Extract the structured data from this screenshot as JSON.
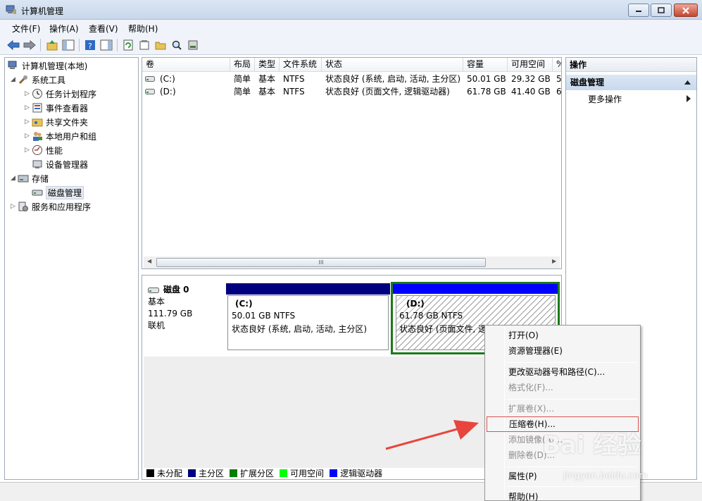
{
  "window": {
    "title": "计算机管理"
  },
  "menu": [
    "文件(F)",
    "操作(A)",
    "查看(V)",
    "帮助(H)"
  ],
  "tree": {
    "root": "计算机管理(本地)",
    "items": [
      {
        "label": "系统工具",
        "icon": "tools-icon"
      },
      {
        "label": "任务计划程序",
        "icon": "clock-icon"
      },
      {
        "label": "事件查看器",
        "icon": "event-viewer-icon"
      },
      {
        "label": "共享文件夹",
        "icon": "shared-folder-icon"
      },
      {
        "label": "本地用户和组",
        "icon": "users-icon"
      },
      {
        "label": "性能",
        "icon": "performance-icon"
      },
      {
        "label": "设备管理器",
        "icon": "device-manager-icon"
      },
      {
        "label": "存储",
        "icon": "storage-icon"
      },
      {
        "label": "磁盘管理",
        "icon": "disk-icon"
      },
      {
        "label": "服务和应用程序",
        "icon": "services-icon"
      }
    ]
  },
  "columns": [
    "卷",
    "布局",
    "类型",
    "文件系统",
    "状态",
    "容量",
    "可用空间",
    "%"
  ],
  "volumes": [
    {
      "name": "(C:)",
      "layout": "简单",
      "type": "基本",
      "fs": "NTFS",
      "status": "状态良好 (系统, 启动, 活动, 主分区)",
      "capacity": "50.01 GB",
      "free": "29.32 GB",
      "pct": "5"
    },
    {
      "name": "(D:)",
      "layout": "简单",
      "type": "基本",
      "fs": "NTFS",
      "status": "状态良好 (页面文件, 逻辑驱动器)",
      "capacity": "61.78 GB",
      "free": "41.40 GB",
      "pct": "6"
    }
  ],
  "scroll_thumb": "III",
  "disk": {
    "name": "磁盘 0",
    "type": "基本",
    "size": "111.79 GB",
    "state": "联机",
    "partitions": [
      {
        "letter": "(C:)",
        "size": "50.01 GB NTFS",
        "status": "状态良好 (系统, 启动, 活动, 主分区)",
        "color": "#00007f"
      },
      {
        "letter": "(D:)",
        "size": "61.78 GB NTFS",
        "status": "状态良好 (页面文件, 逻辑驱动器)",
        "color": "#0000ff"
      }
    ]
  },
  "legend": [
    {
      "label": "未分配",
      "color": "#000000"
    },
    {
      "label": "主分区",
      "color": "#00007f"
    },
    {
      "label": "扩展分区",
      "color": "#008000"
    },
    {
      "label": "可用空间",
      "color": "#00ff00"
    },
    {
      "label": "逻辑驱动器",
      "color": "#0000ff"
    }
  ],
  "actions": {
    "header": "操作",
    "selected": "磁盘管理",
    "more": "更多操作"
  },
  "context_menu": [
    {
      "label": "打开(O)",
      "enabled": true
    },
    {
      "label": "资源管理器(E)",
      "enabled": true
    },
    {
      "label": "更改驱动器号和路径(C)...",
      "enabled": true
    },
    {
      "label": "格式化(F)...",
      "enabled": false
    },
    {
      "label": "扩展卷(X)...",
      "enabled": false
    },
    {
      "label": "压缩卷(H)...",
      "enabled": true,
      "highlighted": true
    },
    {
      "label": "添加镜像(A)...",
      "enabled": false
    },
    {
      "label": "删除卷(D)...",
      "enabled": false
    },
    {
      "label": "属性(P)",
      "enabled": true
    },
    {
      "label": "帮助(H)",
      "enabled": true
    }
  ],
  "watermark": {
    "brand": "Bai 经验",
    "url": "jingyan.baidu.com"
  },
  "colors": {
    "annotation_red": "#e8453c",
    "highlight_box": "#d9534f"
  }
}
